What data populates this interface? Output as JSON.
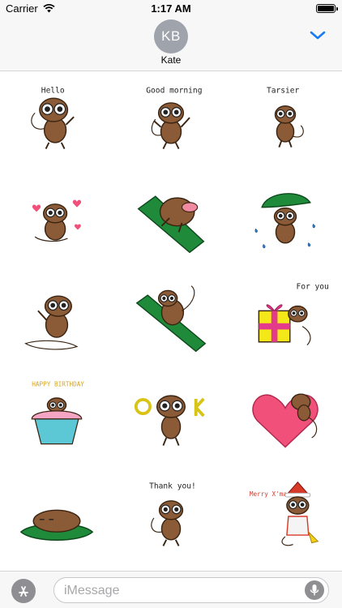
{
  "status_bar": {
    "carrier": "Carrier",
    "time": "1:17 AM",
    "wifi_icon": "wifi-icon",
    "battery_level": 1.0
  },
  "header": {
    "avatar_initials": "KB",
    "contact_name": "Kate",
    "collapse_icon": "chevron-down-icon",
    "accent_color": "#1a7cf5"
  },
  "stickers": [
    {
      "name": "hello",
      "caption": "Hello"
    },
    {
      "name": "good-morning",
      "caption": "Good morning"
    },
    {
      "name": "tarsier",
      "caption": "Tarsier"
    },
    {
      "name": "hearts",
      "caption": ""
    },
    {
      "name": "hug-leaf",
      "caption": ""
    },
    {
      "name": "rain-leaf",
      "caption": ""
    },
    {
      "name": "wave",
      "caption": ""
    },
    {
      "name": "climb-branch",
      "caption": ""
    },
    {
      "name": "for-you-gift",
      "caption": "For you"
    },
    {
      "name": "happy-birthday",
      "caption": "HAPPY BIRTHDAY"
    },
    {
      "name": "ok",
      "caption": "OK"
    },
    {
      "name": "heart",
      "caption": ""
    },
    {
      "name": "sleep-leaf",
      "caption": ""
    },
    {
      "name": "thank-you",
      "caption": "Thank you!"
    },
    {
      "name": "merry-xmas",
      "caption": "Merry X'mas"
    }
  ],
  "input_bar": {
    "apps_icon": "app-store-icon",
    "placeholder": "iMessage",
    "mic_icon": "microphone-icon"
  },
  "colors": {
    "tarsier_brown": "#8b5a36",
    "leaf_green": "#1f8a3a",
    "heart_pink": "#f0507a"
  }
}
